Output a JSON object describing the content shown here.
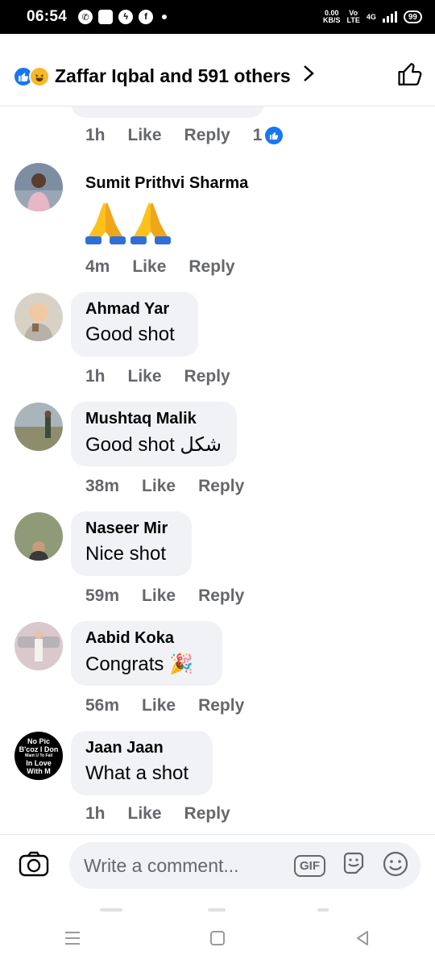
{
  "status_bar": {
    "time": "06:54",
    "speed_value": "0.00",
    "speed_unit": "KB/S",
    "volte_top": "Vo",
    "volte_bottom": "LTE",
    "network": "4G",
    "battery": "99"
  },
  "header": {
    "reaction_icons": [
      "like-icon",
      "haha-icon"
    ],
    "reactions_text": "Zaffar Iqbal and 591 others",
    "chevron": "›"
  },
  "previous_comment": {
    "time": "1h",
    "like": "Like",
    "reply": "Reply",
    "reaction_count": "1"
  },
  "comments": [
    {
      "name": "Sumit Prithvi Sharma",
      "text": "",
      "emoji": [
        "folded-hands",
        "folded-hands"
      ],
      "time": "4m",
      "like": "Like",
      "reply": "Reply"
    },
    {
      "name": "Ahmad Yar",
      "text": "Good shot",
      "time": "1h",
      "like": "Like",
      "reply": "Reply"
    },
    {
      "name": "Mushtaq Malik",
      "text": " Good shot شکل",
      "time": "38m",
      "like": "Like",
      "reply": "Reply"
    },
    {
      "name": "Naseer Mir",
      "text": "Nice shot",
      "time": "59m",
      "like": "Like",
      "reply": "Reply"
    },
    {
      "name": "Aabid Koka",
      "text": "Congrats 🎉",
      "time": "56m",
      "like": "Like",
      "reply": "Reply"
    },
    {
      "name": "Jaan Jaan",
      "text": "What a shot",
      "time": "1h",
      "like": "Like",
      "reply": "Reply",
      "avatar_text": [
        "No Pic",
        "B'coz I Don",
        "Want U To Fall",
        "In Love",
        "With M"
      ]
    }
  ],
  "composer": {
    "placeholder": "Write a comment...",
    "gif_label": "GIF"
  },
  "colors": {
    "facebook_blue": "#1877f2",
    "bubble_gray": "#f0f2f5",
    "secondary_text": "#65676b"
  }
}
